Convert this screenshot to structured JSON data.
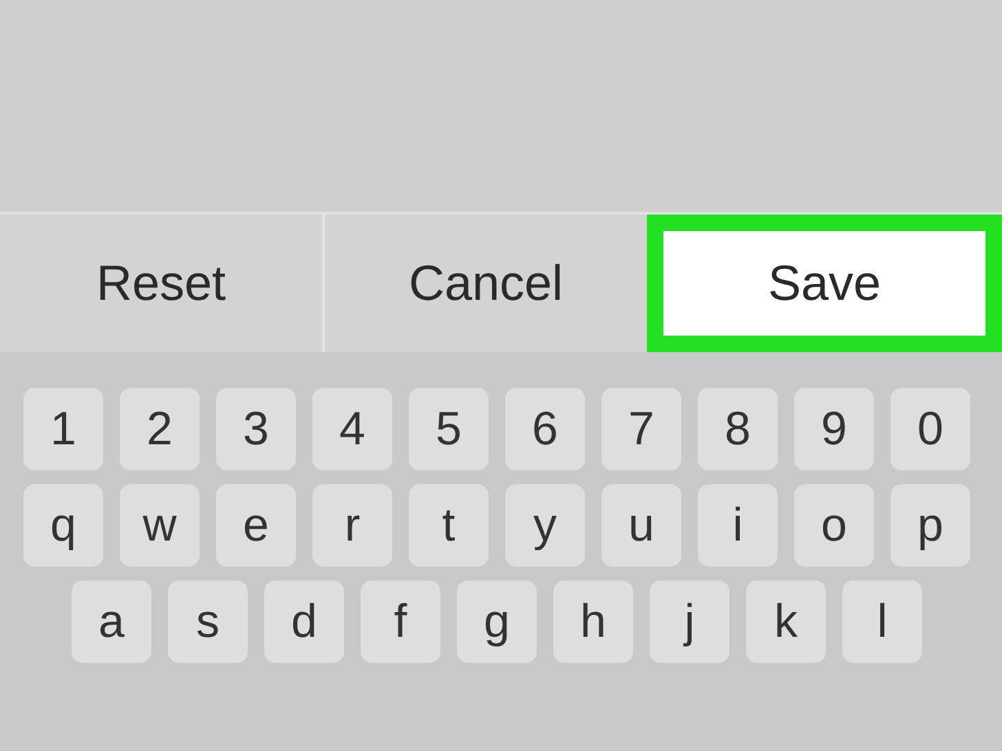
{
  "action_buttons": [
    {
      "label": "Reset",
      "highlighted": false
    },
    {
      "label": "Cancel",
      "highlighted": false
    },
    {
      "label": "Save",
      "highlighted": true
    }
  ],
  "keyboard_rows": [
    [
      "1",
      "2",
      "3",
      "4",
      "5",
      "6",
      "7",
      "8",
      "9",
      "0"
    ],
    [
      "q",
      "w",
      "e",
      "r",
      "t",
      "y",
      "u",
      "i",
      "o",
      "p"
    ],
    [
      "a",
      "s",
      "d",
      "f",
      "g",
      "h",
      "j",
      "k",
      "l"
    ]
  ]
}
